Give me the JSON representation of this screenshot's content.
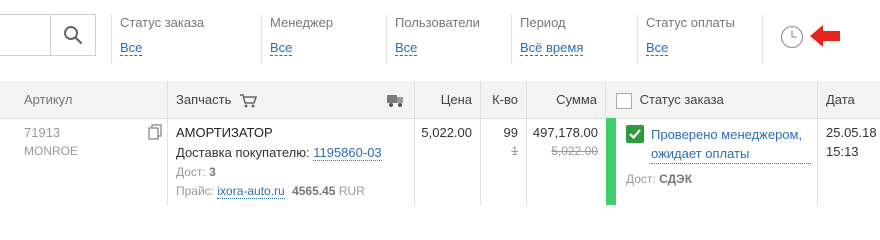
{
  "filters": {
    "order_status": {
      "label": "Статус заказа",
      "value": "Все"
    },
    "manager": {
      "label": "Менеджер",
      "value": "Все"
    },
    "users": {
      "label": "Пользователи",
      "value": "Все"
    },
    "period": {
      "label": "Период",
      "value": "Всё время"
    },
    "payment_status": {
      "label": "Статус оплаты",
      "value": "Все"
    }
  },
  "table": {
    "headers": {
      "article": "Артикул",
      "part": "Запчасть",
      "price": "Цена",
      "qty": "К-во",
      "sum": "Сумма",
      "status": "Статус заказа",
      "date": "Дата"
    },
    "rows": [
      {
        "article": "71913",
        "brand": "MONROE",
        "part_name": "АМОРТИЗАТОР",
        "delivery_label": "Доставка покупателю:",
        "delivery_order": "1195860-03",
        "dost_label": "Дост:",
        "dost_value": "3",
        "price_label": "Прайс:",
        "price_source": "ixora-auto.ru",
        "price_purchase": "4565.45",
        "price_currency": "RUR",
        "price": "5,022.00",
        "qty": "99",
        "qty_old": "1",
        "sum": "497,178.00",
        "sum_old": "5,022.00",
        "status_text": "Проверено менеджером, ожидает оплаты",
        "delivery_method_label": "Дост:",
        "delivery_method": "СДЭК",
        "date": "25.05.18",
        "time": "15:13"
      }
    ]
  },
  "colors": {
    "link": "#2a6fb5",
    "status_bar": "#3ecf6b",
    "check": "#2e9a3c",
    "arrow": "#e8231f"
  }
}
